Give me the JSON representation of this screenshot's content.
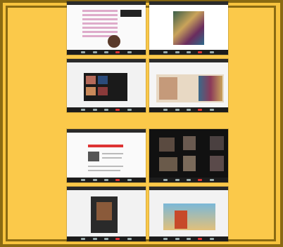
{
  "collage": {
    "panels": [
      {
        "name": "panel-1",
        "desc_icon": "slide-icon"
      },
      {
        "name": "panel-2",
        "desc_icon": "slide-icon"
      },
      {
        "name": "panel-3",
        "desc_icon": "slide-icon"
      },
      {
        "name": "panel-4",
        "desc_icon": "slide-icon"
      },
      {
        "name": "panel-5",
        "desc_icon": "slide-icon"
      },
      {
        "name": "panel-6",
        "desc_icon": "video-call-icon"
      },
      {
        "name": "panel-7",
        "desc_icon": "slide-icon"
      },
      {
        "name": "panel-8",
        "desc_icon": "slide-icon"
      }
    ],
    "colors": {
      "background": "#f7c33e",
      "border": "#8a6a12",
      "toolbar": "#1c1c1c"
    }
  }
}
